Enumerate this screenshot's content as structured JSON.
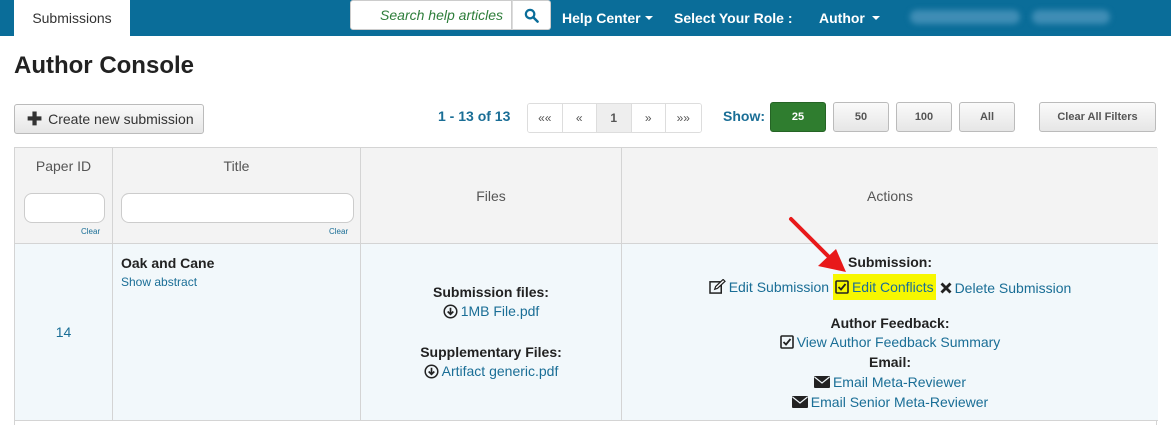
{
  "nav": {
    "tab_submissions": "Submissions",
    "search_placeholder": "Search help articles",
    "help_center": "Help Center",
    "select_role": "Select Your Role :",
    "role": "Author"
  },
  "page": {
    "title": "Author Console"
  },
  "toolbar": {
    "create_label": "Create new submission",
    "count_text": "1 - 13 of 13",
    "pager": [
      "««",
      "«",
      "1",
      "»",
      "»»"
    ],
    "pager_current": "1",
    "show_label": "Show:",
    "page_sizes": [
      "25",
      "50",
      "100",
      "All"
    ],
    "page_size_selected": "25",
    "clear_filters": "Clear All Filters"
  },
  "table": {
    "headers": {
      "paper_id": "Paper ID",
      "title": "Title",
      "files": "Files",
      "actions": "Actions"
    },
    "filter_clear": "Clear",
    "rows": [
      {
        "paper_id": "14",
        "title": "Oak and Cane",
        "show_abstract": "Show abstract",
        "submission_files_label": "Submission files:",
        "submission_file": "1MB File.pdf",
        "supplementary_label": "Supplementary Files:",
        "supplementary_file": "Artifact generic.pdf",
        "submission_label": "Submission:",
        "edit_submission": "Edit Submission",
        "edit_conflicts": "Edit Conflicts",
        "delete_submission": "Delete Submission",
        "author_feedback_label": "Author Feedback:",
        "view_feedback": "View Author Feedback Summary",
        "email_label": "Email:",
        "email_meta": "Email Meta-Reviewer",
        "email_senior": "Email Senior Meta-Reviewer"
      }
    ]
  },
  "colors": {
    "nav_bg": "#0a6d99",
    "link": "#1a6e96",
    "active_size": "#2f7d2f",
    "highlight": "#f7f700",
    "arrow": "#e8191a"
  }
}
